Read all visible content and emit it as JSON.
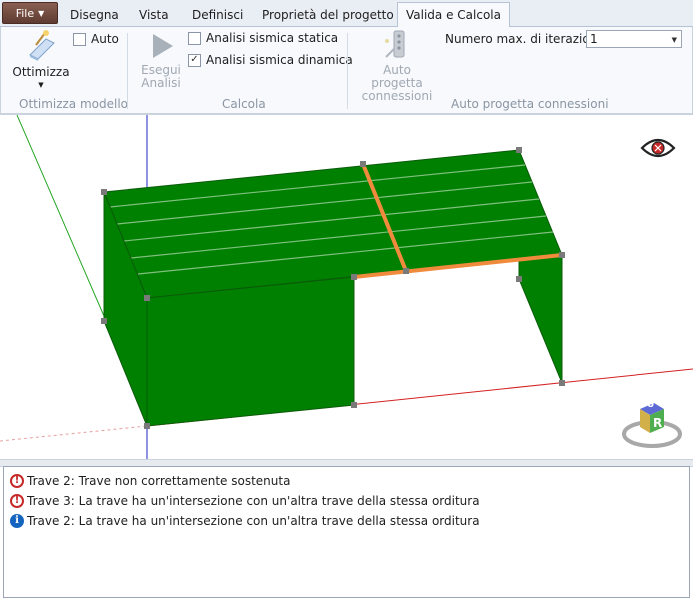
{
  "menu": {
    "file_label": "File"
  },
  "tabs": [
    {
      "label": "Disegna"
    },
    {
      "label": "Vista"
    },
    {
      "label": "Definisci"
    },
    {
      "label": "Proprietà del progetto"
    },
    {
      "label": "Valida e Calcola",
      "active": true
    }
  ],
  "ribbon": {
    "optimize": {
      "label": "Ottimizza",
      "auto_label": "Auto",
      "auto_checked": false,
      "group_label": "Ottimizza modello"
    },
    "calc": {
      "run_label_1": "Esegui",
      "run_label_2": "Analisi",
      "static_label": "Analisi sismica statica",
      "static_checked": false,
      "dynamic_label": "Analisi sismica dinamica",
      "dynamic_checked": true,
      "group_label": "Calcola"
    },
    "connections": {
      "button_label_1": "Auto progetta",
      "button_label_2": "connessioni",
      "iterations_label": "Numero max. di iterazioni",
      "iterations_value": "1",
      "group_label": "Auto progetta connessioni"
    }
  },
  "viewcube": {
    "top_label": "U",
    "front_label": "R"
  },
  "colors": {
    "accent": "#f08a3c",
    "structure": "#008000",
    "warning": "#c62828",
    "info": "#1565c0"
  },
  "messages": [
    {
      "type": "warning",
      "icon": "warning-icon",
      "text": "Trave 2: Trave non correttamente sostenuta"
    },
    {
      "type": "warning",
      "icon": "warning-icon",
      "text": "Trave 3: La trave ha un'intersezione con un'altra trave della stessa orditura"
    },
    {
      "type": "info",
      "icon": "info-icon",
      "text": "Trave 2: La trave ha un'intersezione con un'altra trave della stessa orditura"
    }
  ]
}
